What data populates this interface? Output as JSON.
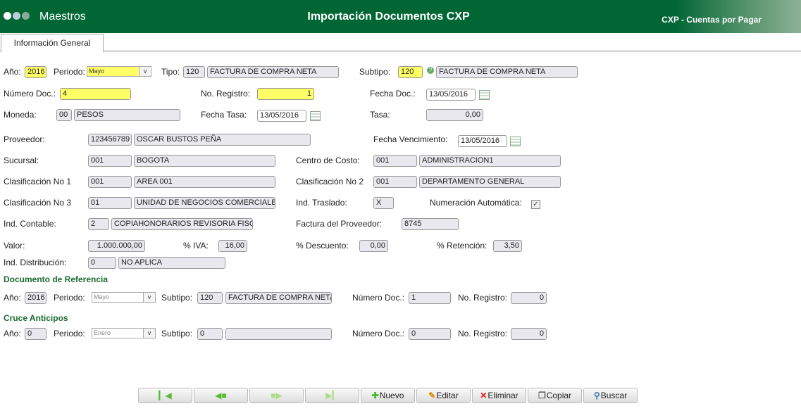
{
  "header": {
    "menu": "Maestros",
    "title": "Importación Documentos CXP",
    "module": "CXP - Cuentas por Pagar"
  },
  "tab": "Información General",
  "labels": {
    "anio": "Año:",
    "periodo": "Periodo:",
    "tipo": "Tipo:",
    "subtipo": "Subtipo:",
    "numero_doc": "Número Doc.:",
    "no_registro": "No. Registro:",
    "fecha_doc": "Fecha Doc.:",
    "moneda": "Moneda:",
    "fecha_tasa": "Fecha Tasa:",
    "tasa": "Tasa:",
    "proveedor": "Proveedor:",
    "fecha_venc": "Fecha Vencimiento:",
    "sucursal": "Sucursal:",
    "centro_costo": "Centro de Costo:",
    "clasif1": "Clasificación No 1",
    "clasif2": "Clasificación No 2",
    "clasif3": "Clasificación No 3",
    "ind_traslado": "Ind. Traslado:",
    "numeracion": "Numeración Automática:",
    "ind_contable": "Ind. Contable:",
    "factura_prov": "Factura del Proveedor:",
    "valor": "Valor:",
    "iva": "% IVA:",
    "descuento": "% Descuento:",
    "retencion": "% Retención:",
    "ind_distribucion": "Ind. Distribución:"
  },
  "form": {
    "anio": "2016",
    "periodo": "Mayo",
    "tipo_code": "120",
    "tipo_name": "FACTURA DE COMPRA NETA",
    "subtipo_code": "120",
    "subtipo_name": "FACTURA DE COMPRA NETA",
    "numero_doc": "4",
    "no_registro": "1",
    "fecha_doc": "13/05/2016",
    "moneda_code": "00",
    "moneda_name": "PESOS",
    "fecha_tasa": "13/05/2016",
    "tasa": "0,00",
    "proveedor_code": "123456789",
    "proveedor_name": "OSCAR BUSTOS PEÑA",
    "fecha_venc": "13/05/2016",
    "sucursal_code": "001",
    "sucursal_name": "BOGOTA",
    "centro_code": "001",
    "centro_name": "ADMINISTRACION1",
    "clasif1_code": "001",
    "clasif1_name": "AREA 001",
    "clasif2_code": "001",
    "clasif2_name": "DEPARTAMENTO GENERAL",
    "clasif3_code": "01",
    "clasif3_name": "UNIDAD DE NEGOCIOS COMERCIALES",
    "ind_traslado": "X",
    "numeracion_checked": true,
    "ind_contable_code": "2",
    "ind_contable_name": "COPIAHONORARIOS REVISORIA FISC",
    "factura_prov": "8745",
    "valor": "1.000.000,00",
    "iva": "16,00",
    "descuento": "0,00",
    "retencion": "3,50",
    "ind_dist_code": "0",
    "ind_dist_name": "NO APLICA"
  },
  "referencia": {
    "heading": "Documento de Referencia",
    "anio": "2016",
    "periodo": "Mayo",
    "subtipo_code": "120",
    "subtipo_name": "FACTURA DE COMPRA NETA",
    "numero_doc": "1",
    "no_registro": "0"
  },
  "cruce": {
    "heading": "Cruce Anticipos",
    "anio": "0",
    "periodo": "Enero",
    "subtipo_code": "0",
    "subtipo_name": "",
    "numero_doc": "0",
    "no_registro": "0"
  },
  "toolbar": {
    "nuevo": "Nuevo",
    "editar": "Editar",
    "eliminar": "Eliminar",
    "copiar": "Copiar",
    "buscar": "Buscar"
  },
  "colors": {
    "header": "#006634",
    "required": "#ffff66",
    "heading": "#1a6b2e"
  }
}
